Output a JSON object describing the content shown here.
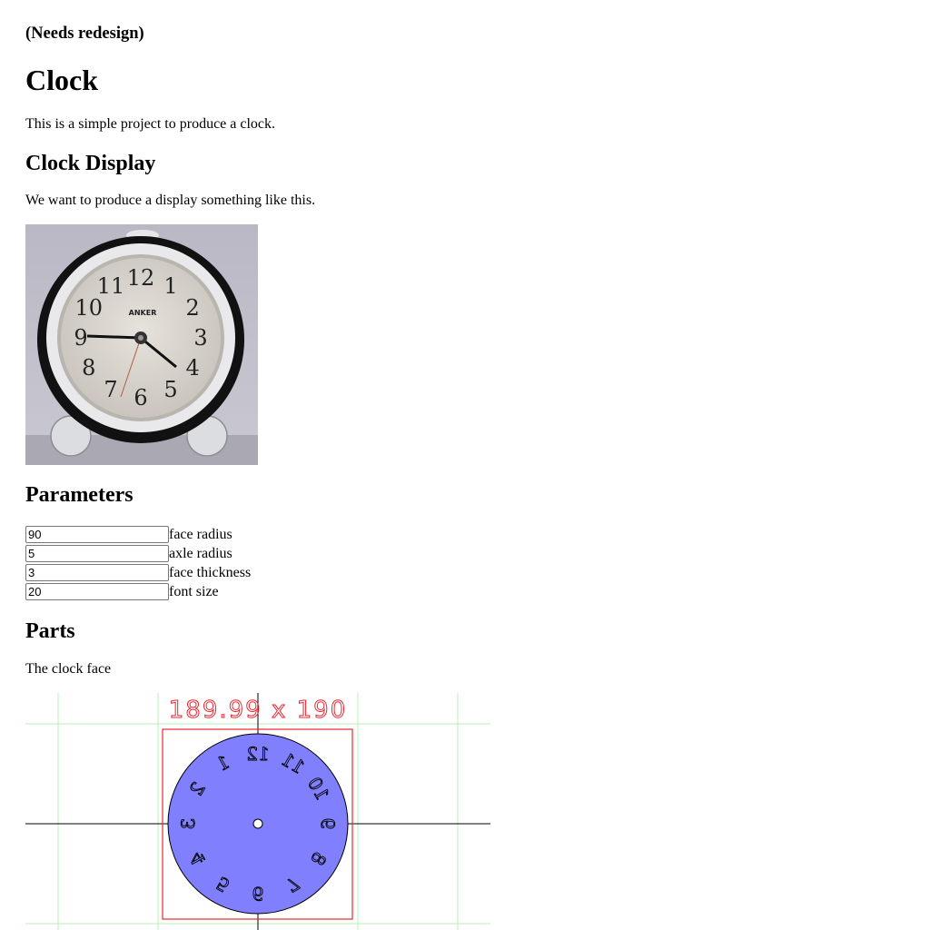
{
  "status_note": "(Needs redesign)",
  "title": "Clock",
  "intro": "This is a simple project to produce a clock.",
  "display": {
    "heading": "Clock Display",
    "text": "We want to produce a display something like this.",
    "clock_brand": "ANKER",
    "clock_numerals": [
      "12",
      "1",
      "2",
      "3",
      "4",
      "5",
      "6",
      "7",
      "8",
      "9",
      "10",
      "11"
    ]
  },
  "parameters": {
    "heading": "Parameters",
    "fields": [
      {
        "value": "90",
        "label": "face radius"
      },
      {
        "value": "5",
        "label": "axle radius"
      },
      {
        "value": "3",
        "label": "face thickness"
      },
      {
        "value": "20",
        "label": "font size"
      }
    ]
  },
  "parts": {
    "heading": "Parts",
    "text": "The clock face",
    "dimension_label": "189.99 x 190",
    "face_numerals": [
      "12",
      "1",
      "2",
      "3",
      "4",
      "5",
      "6",
      "7",
      "8",
      "9",
      "10",
      "11"
    ],
    "colors": {
      "face": "#8080ff",
      "bbox": "#e8262e",
      "grid": "#b6f0b6",
      "axis": "#000000"
    }
  }
}
